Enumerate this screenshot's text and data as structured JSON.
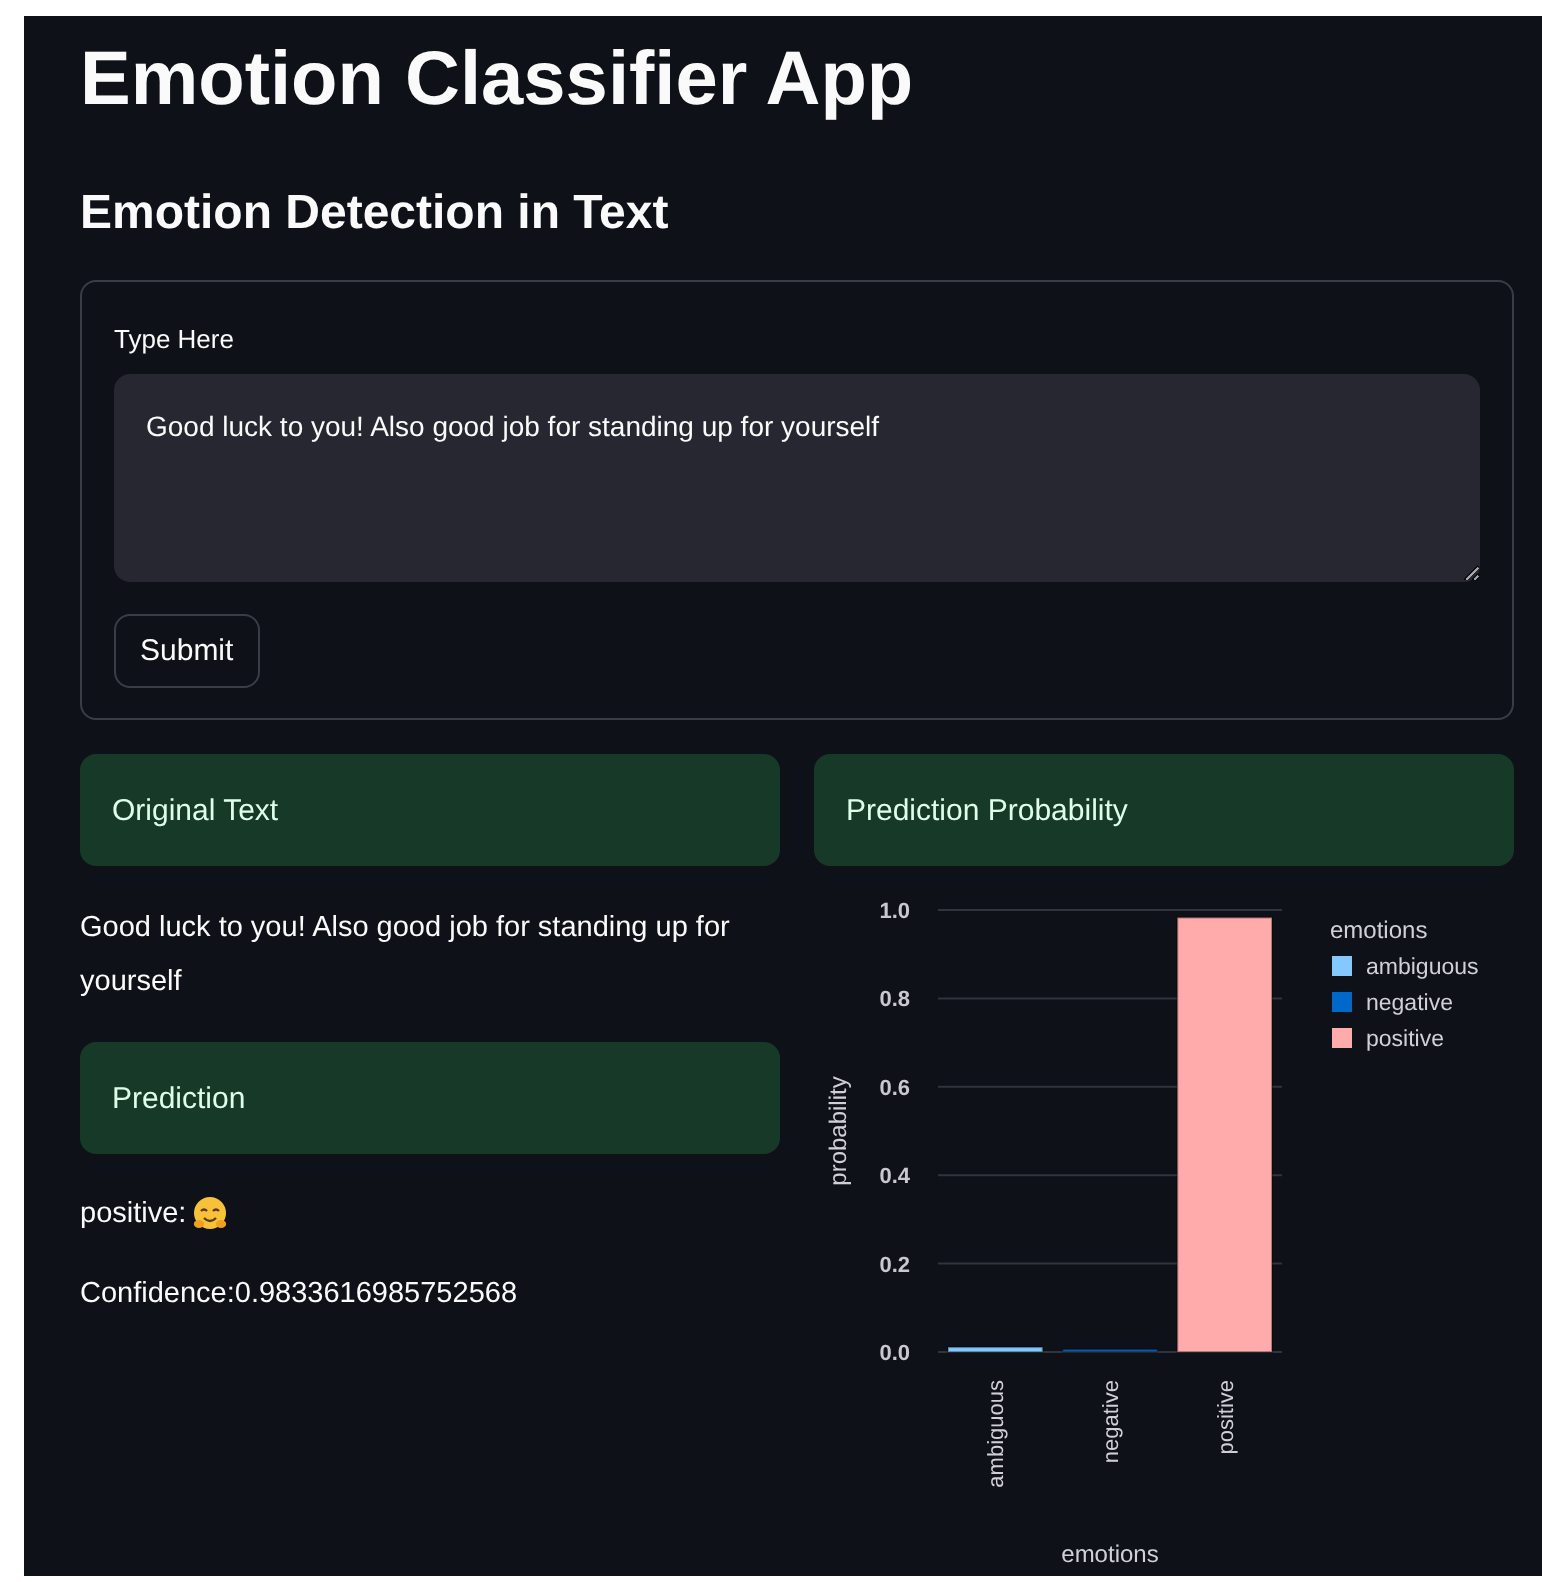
{
  "title": "Emotion Classifier App",
  "subtitle": "Emotion Detection in Text",
  "form": {
    "label": "Type Here",
    "value": "Good luck to you! Also good job for standing up for yourself",
    "button": "Submit"
  },
  "left": {
    "original_header": "Original Text",
    "original_text": "Good luck to you! Also good job for standing up for yourself",
    "prediction_header": "Prediction",
    "prediction": "positive:",
    "confidence": "Confidence:0.9833616985752568"
  },
  "right": {
    "header": "Prediction Probability",
    "chart_data": {
      "type": "bar",
      "xlabel": "emotions",
      "ylabel": "probability",
      "categories": [
        "ambiguous",
        "negative",
        "positive"
      ],
      "series": [
        {
          "name": "ambiguous",
          "color": "#83c9ff",
          "values": [
            0.011,
            null,
            null
          ]
        },
        {
          "name": "negative",
          "color": "#0068c9",
          "values": [
            null,
            0.006,
            null
          ]
        },
        {
          "name": "positive",
          "color": "#ffabab",
          "values": [
            null,
            null,
            0.983
          ]
        }
      ],
      "ylim": [
        0,
        1
      ],
      "yticks": [
        {
          "value": 0,
          "label": "0.0"
        },
        {
          "value": 0.2,
          "label": "0.2"
        },
        {
          "value": 0.4,
          "label": "0.4"
        },
        {
          "value": 0.6,
          "label": "0.6"
        },
        {
          "value": 0.8,
          "label": "0.8"
        },
        {
          "value": 1,
          "label": "1.0"
        }
      ],
      "grid": true,
      "legend": {
        "title": "emotions"
      }
    }
  }
}
